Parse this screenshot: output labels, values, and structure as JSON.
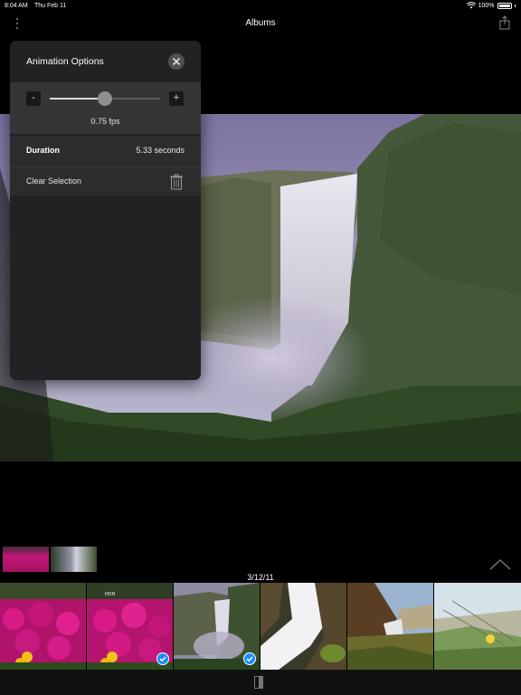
{
  "status_bar": {
    "time": "8:04 AM",
    "date": "Thu Feb 11",
    "battery": "100%"
  },
  "nav": {
    "title": "Albums"
  },
  "popover": {
    "title": "Animation Options",
    "fps_minus_label": "-",
    "fps_plus_label": "+",
    "fps_label": "0.75 fps",
    "fps_slider_fraction": 0.5,
    "duration_label": "Duration",
    "duration_value": "5.33 seconds",
    "clear_selection_label": "Clear Selection"
  },
  "strip": {
    "date": "3/12/11",
    "hdr_badge": "HDR"
  },
  "colors": {
    "accent": "#1a8cff",
    "popover_bg": "#222224",
    "popover_slider_bg": "#353537"
  }
}
